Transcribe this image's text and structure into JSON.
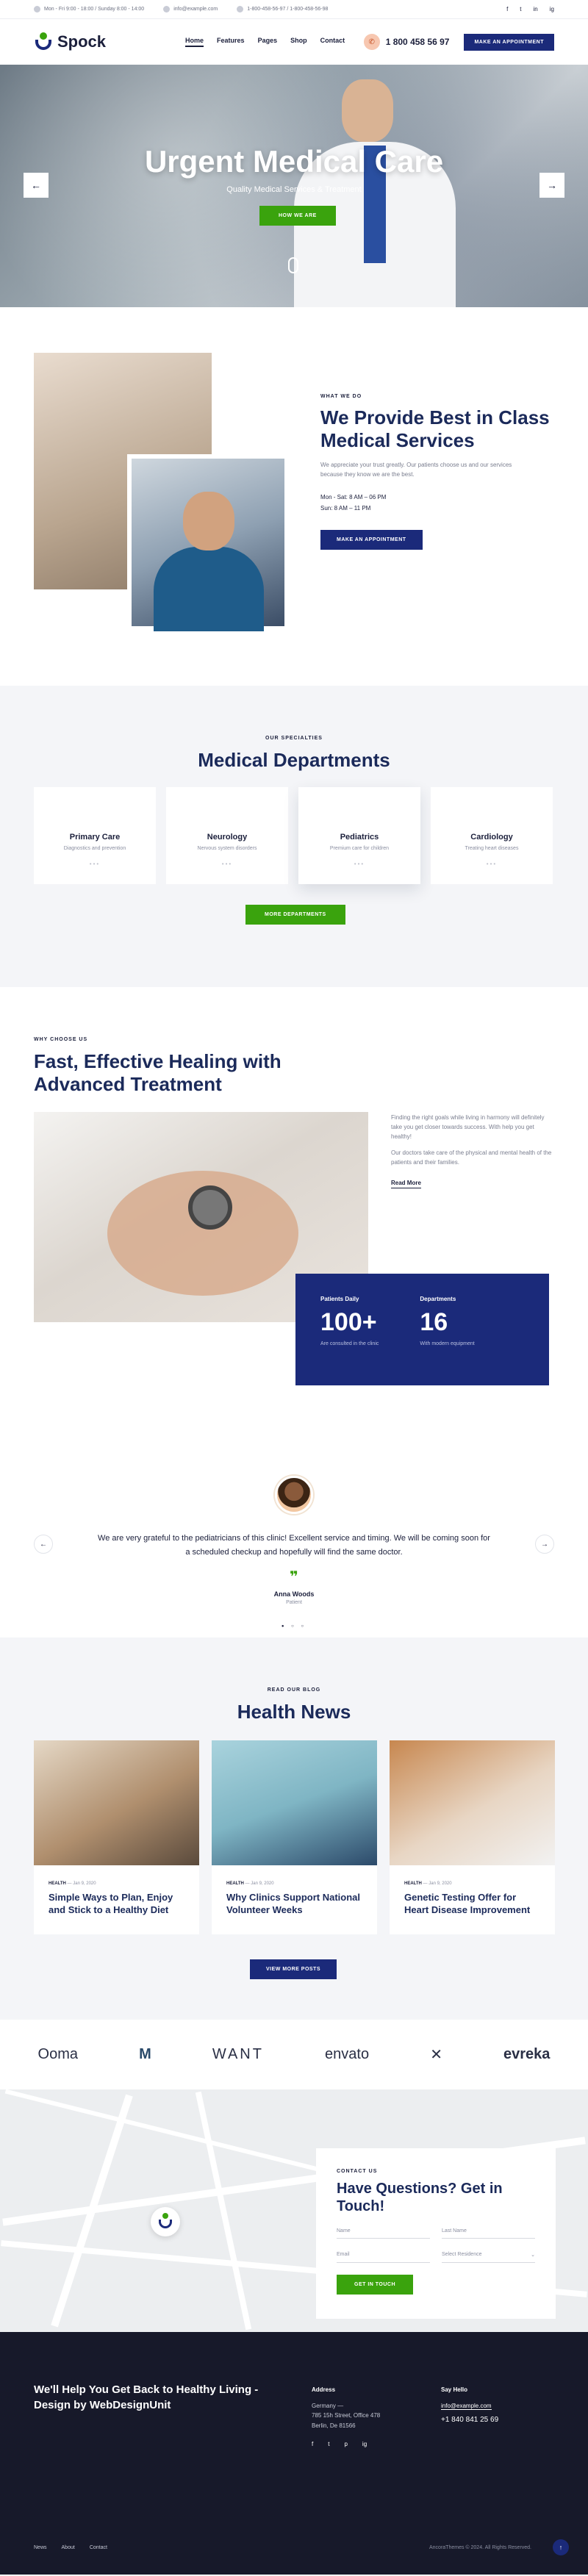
{
  "topbar": {
    "items": [
      "Mon - Fri 9:00 - 18:00 / Sunday 8:00 - 14:00",
      "info@example.com",
      "1-800-458-56-97 / 1-800-458-56-98"
    ],
    "social": [
      "f",
      "t",
      "in",
      "ig"
    ]
  },
  "header": {
    "logo": "Spock",
    "nav": [
      "Home",
      "Features",
      "Pages",
      "Shop",
      "Contact"
    ],
    "phone": "1 800 458 56 97",
    "cta": "MAKE AN APPOINTMENT"
  },
  "hero": {
    "title": "Urgent Medical Care",
    "subtitle": "Quality Medical Services & Treatment",
    "cta": "HOW WE ARE",
    "prev": "←",
    "next": "→"
  },
  "about": {
    "eyebrow": "WHAT WE DO",
    "title": "We Provide Best in Class Medical Services",
    "text": "We appreciate your trust greatly. Our patients choose us and our services because they know we are the best.",
    "hours1": "Mon - Sat: 8 AM – 06 PM",
    "hours2": "Sun: 8 AM – 11 PM",
    "cta": "MAKE AN APPOINTMENT"
  },
  "departments": {
    "eyebrow": "OUR SPECIALTIES",
    "title": "Medical Departments",
    "cards": [
      {
        "title": "Primary Care",
        "sub": "Diagnostics and prevention"
      },
      {
        "title": "Neurology",
        "sub": "Nervous system disorders"
      },
      {
        "title": "Pediatrics",
        "sub": "Premium care for children"
      },
      {
        "title": "Cardiology",
        "sub": "Treating heart diseases"
      }
    ],
    "cta": "MORE DEPARTMENTS"
  },
  "why": {
    "eyebrow": "WHY CHOOSE US",
    "title": "Fast, Effective Healing with Advanced Treatment",
    "text1": "Finding the right goals while living in harmony will definitely take you get closer towards success. With help you get healthy!",
    "text2": "Our doctors take care of the physical and mental health of the patients and their families.",
    "read_more": "Read More",
    "stats": [
      {
        "label": "Patients Daily",
        "value": "100+",
        "desc": "Are consulted in the clinic"
      },
      {
        "label": "Departments",
        "value": "16",
        "desc": "With modern equipment"
      }
    ]
  },
  "testimonial": {
    "quote": "We are very grateful to the pediatricians of this clinic! Excellent service and timing. We will be coming soon for a scheduled checkup and hopefully will find the same doctor.",
    "name": "Anna Woods",
    "role": "Patient",
    "prev": "←",
    "next": "→"
  },
  "news": {
    "eyebrow": "READ OUR BLOG",
    "title": "Health News",
    "posts": [
      {
        "cat": "HEALTH",
        "date": "Jan 9, 2020",
        "title": "Simple Ways to Plan, Enjoy and Stick to a Healthy Diet"
      },
      {
        "cat": "HEALTH",
        "date": "Jan 9, 2020",
        "title": "Why Clinics Support National Volunteer Weeks"
      },
      {
        "cat": "HEALTH",
        "date": "Jan 9, 2020",
        "title": "Genetic Testing Offer for Heart Disease Improvement"
      }
    ],
    "cta": "VIEW MORE POSTS"
  },
  "partners": [
    "Ooma",
    "M",
    "WANT",
    "envato",
    "✕",
    "evreka"
  ],
  "contact": {
    "eyebrow": "CONTACT US",
    "title": "Have Questions? Get in Touch!",
    "name_placeholder": "Name",
    "lastname_placeholder": "Last Name",
    "email_placeholder": "Email",
    "select_label": "Select Residence",
    "cta": "GET IN TOUCH"
  },
  "footer": {
    "heading": "We'll Help You Get Back to Healthy Living - Design by WebDesignUnit",
    "address_title": "Address",
    "address": [
      "Germany —",
      "785 15h Street, Office 478",
      "Berlin, De 81566"
    ],
    "hello_title": "Say Hello",
    "email": "info@example.com",
    "phone": "+1 840 841 25 69",
    "social": [
      "f",
      "t",
      "p",
      "ig"
    ],
    "links": [
      "News",
      "About",
      "Contact"
    ],
    "copyright": "AncoraThemes © 2024. All Rights Reserved.",
    "top": "↑"
  },
  "colors": {
    "navy": "#1b2a7a",
    "green": "#3aa30d",
    "dark": "#17192a"
  }
}
